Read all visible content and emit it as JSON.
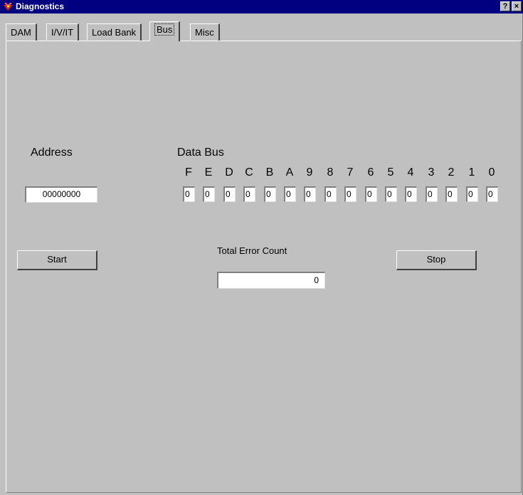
{
  "window": {
    "title": "Diagnostics",
    "help_label": "?",
    "close_label": "×"
  },
  "tabs": [
    {
      "label": "DAM",
      "active": false
    },
    {
      "label": "I/V/IT",
      "active": false
    },
    {
      "label": "Load Bank",
      "active": false
    },
    {
      "label": "Bus",
      "active": true
    },
    {
      "label": "Misc",
      "active": false
    }
  ],
  "address": {
    "label": "Address",
    "value": "00000000"
  },
  "data_bus": {
    "label": "Data Bus",
    "bits": [
      {
        "name": "F",
        "value": "0"
      },
      {
        "name": "E",
        "value": "0"
      },
      {
        "name": "D",
        "value": "0"
      },
      {
        "name": "C",
        "value": "0"
      },
      {
        "name": "B",
        "value": "0"
      },
      {
        "name": "A",
        "value": "0"
      },
      {
        "name": "9",
        "value": "0"
      },
      {
        "name": "8",
        "value": "0"
      },
      {
        "name": "7",
        "value": "0"
      },
      {
        "name": "6",
        "value": "0"
      },
      {
        "name": "5",
        "value": "0"
      },
      {
        "name": "4",
        "value": "0"
      },
      {
        "name": "3",
        "value": "0"
      },
      {
        "name": "2",
        "value": "0"
      },
      {
        "name": "1",
        "value": "0"
      },
      {
        "name": "0",
        "value": "0"
      }
    ]
  },
  "error_count": {
    "label": "Total Error Count",
    "value": "0"
  },
  "buttons": {
    "start_label": "Start",
    "stop_label": "Stop"
  },
  "colors": {
    "face": "#c0c0c0",
    "titlebar": "#000080"
  }
}
